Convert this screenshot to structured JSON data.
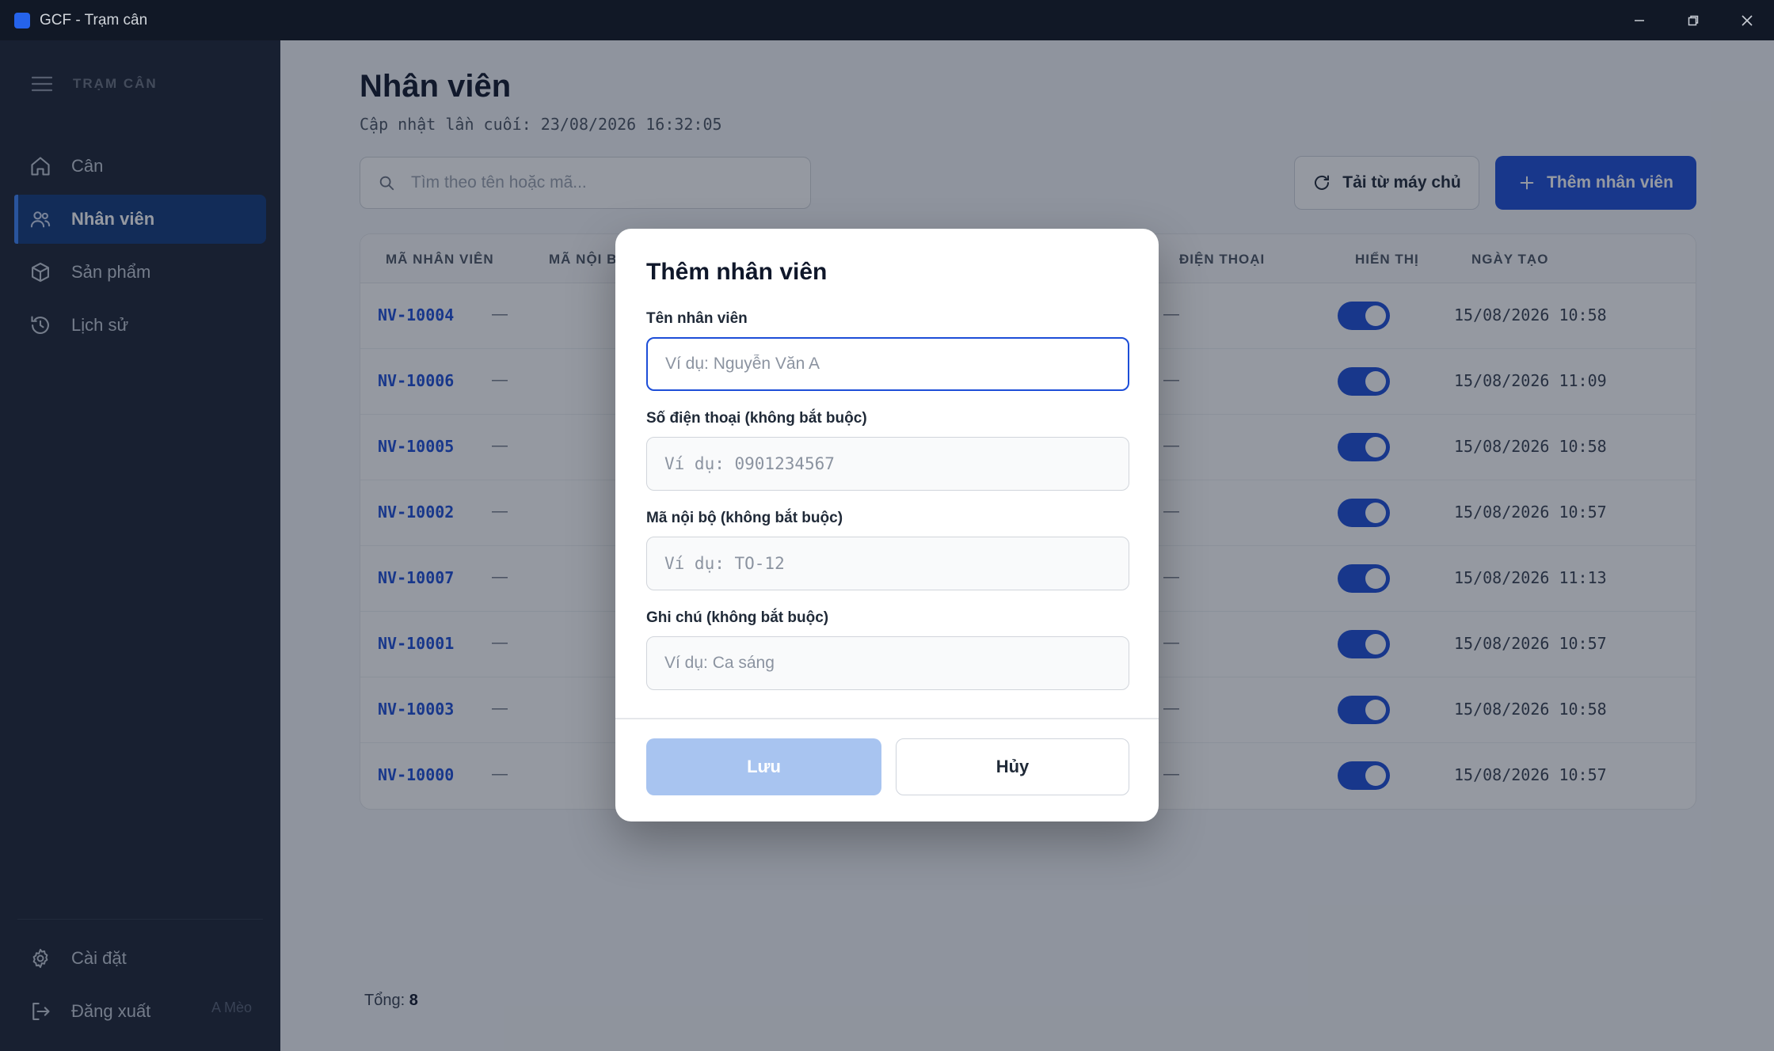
{
  "window": {
    "title": "GCF - Trạm cân"
  },
  "sidebar": {
    "header": "TRẠM CÂN",
    "items": [
      {
        "label": "Cân",
        "icon": "home-icon"
      },
      {
        "label": "Nhân viên",
        "icon": "users-icon",
        "active": true
      },
      {
        "label": "Sản phẩm",
        "icon": "box-icon"
      },
      {
        "label": "Lịch sử",
        "icon": "history-icon"
      }
    ],
    "settings_label": "Cài đặt",
    "logout_label": "Đăng xuất",
    "user_name": "A Mèo"
  },
  "page": {
    "title": "Nhân viên",
    "last_updated": "Cập nhật lần cuối: 23/08/2026 16:32:05",
    "search_placeholder": "Tìm theo tên hoặc mã...",
    "sync_button": "Tải từ máy chủ",
    "add_button": "Thêm nhân viên",
    "total_label": "Tổng:",
    "total_value": "8"
  },
  "table": {
    "columns": [
      "MÃ NHÂN VIÊN",
      "MÃ NỘI B",
      "ĐIỆN THOẠI",
      "HIỂN THỊ",
      "NGÀY TẠO"
    ],
    "rows": [
      {
        "code": "NV-10004",
        "internal": "—",
        "phone": "—",
        "visible": true,
        "created": "15/08/2026 10:58"
      },
      {
        "code": "NV-10006",
        "internal": "—",
        "phone": "—",
        "visible": true,
        "created": "15/08/2026 11:09"
      },
      {
        "code": "NV-10005",
        "internal": "—",
        "phone": "—",
        "visible": true,
        "created": "15/08/2026 10:58"
      },
      {
        "code": "NV-10002",
        "internal": "—",
        "phone": "—",
        "visible": true,
        "created": "15/08/2026 10:57"
      },
      {
        "code": "NV-10007",
        "internal": "—",
        "phone": "—",
        "visible": true,
        "created": "15/08/2026 11:13"
      },
      {
        "code": "NV-10001",
        "internal": "—",
        "phone": "—",
        "visible": true,
        "created": "15/08/2026 10:57"
      },
      {
        "code": "NV-10003",
        "internal": "—",
        "phone": "—",
        "visible": true,
        "created": "15/08/2026 10:58"
      },
      {
        "code": "NV-10000",
        "internal": "—",
        "phone": "—",
        "visible": true,
        "created": "15/08/2026 10:57"
      }
    ]
  },
  "modal": {
    "title": "Thêm nhân viên",
    "fields": [
      {
        "label": "Tên nhân viên",
        "placeholder": "Ví dụ: Nguyễn Văn A",
        "value": ""
      },
      {
        "label": "Số điện thoại (không bắt buộc)",
        "placeholder": "Ví dụ: 0901234567",
        "value": ""
      },
      {
        "label": "Mã nội bộ (không bắt buộc)",
        "placeholder": "Ví dụ: TO-12",
        "value": ""
      },
      {
        "label": "Ghi chú (không bắt buộc)",
        "placeholder": "Ví dụ: Ca sáng",
        "value": ""
      }
    ],
    "save_button": "Lưu",
    "cancel_button": "Hủy"
  },
  "colors": {
    "accent": "#1d4ed8",
    "sidebar": "#1c2434",
    "titlebar": "#111826",
    "save_disabled": "#a8c4f0"
  }
}
